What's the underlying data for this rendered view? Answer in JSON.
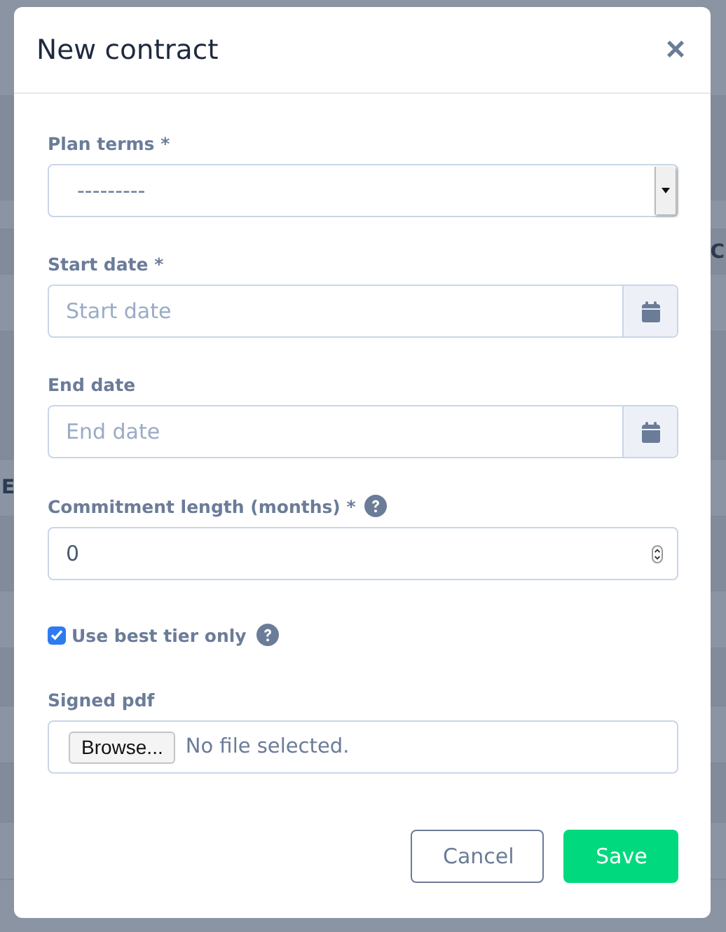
{
  "background": {
    "fragments": [
      {
        "text": "C"
      },
      {
        "text": "E"
      }
    ]
  },
  "modal": {
    "title": "New contract",
    "close": "×",
    "fields": [
      {
        "kind": "select",
        "label": "Plan terms *",
        "value": "---------",
        "help": false
      },
      {
        "kind": "date",
        "label": "Start date *",
        "placeholder": "Start date",
        "help": false
      },
      {
        "kind": "date",
        "label": "End date",
        "placeholder": "End date",
        "help": false
      },
      {
        "kind": "number",
        "label": "Commitment length (months) *",
        "value": "0",
        "help": true
      },
      {
        "kind": "checkbox",
        "label": "Use best tier only",
        "checked": true,
        "help": true
      },
      {
        "kind": "file",
        "label": "Signed pdf",
        "button": "Browse...",
        "status": "No file selected.",
        "help": false
      }
    ],
    "buttons": [
      {
        "kind": "secondary",
        "label": "Cancel"
      },
      {
        "kind": "primary",
        "label": "Save"
      }
    ]
  }
}
